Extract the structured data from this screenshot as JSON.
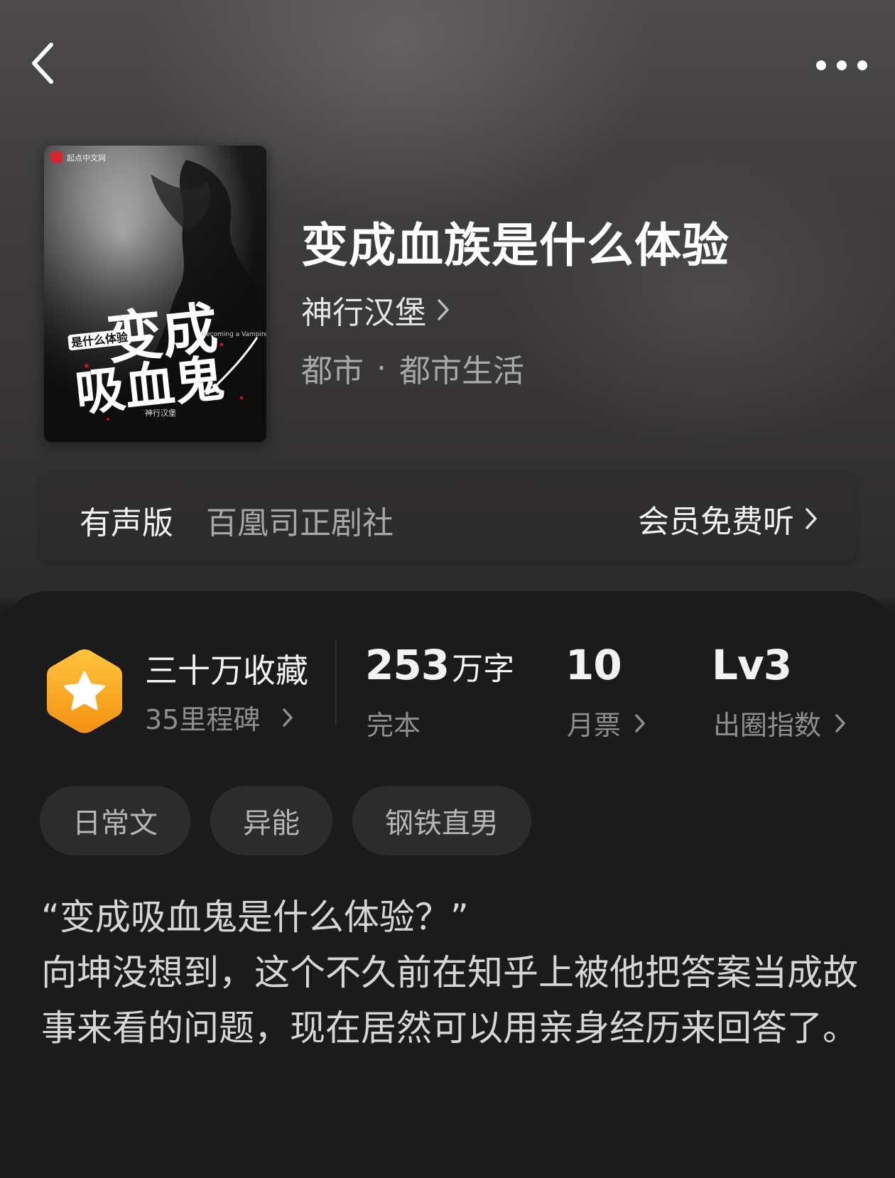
{
  "header": {
    "back_icon": "chevron-left-icon",
    "more_icon": "more-horizontal-icon"
  },
  "book": {
    "cover_alt": "book-cover",
    "title": "变成血族是什么体验",
    "author": "神行汉堡",
    "category": "都市",
    "category_separator": "·",
    "subcategory": "都市生活"
  },
  "audio": {
    "label": "有声版",
    "studio": "百凰司正剧社",
    "cta": "会员免费听"
  },
  "stats": {
    "collection_main": "三十万收藏",
    "collection_sub": "35里程碑",
    "words_value": "253",
    "words_unit": "万字",
    "words_sub": "完本",
    "tickets_value": "10",
    "tickets_sub": "月票",
    "level_value": "Lv3",
    "level_sub": "出圈指数",
    "badge_color": "#F7A21B"
  },
  "tags": [
    "日常文",
    "异能",
    "钢铁直男"
  ],
  "synopsis": {
    "line1": "“变成吸血鬼是什么体验？”",
    "line2": "向坤没想到，这个不久前在知乎上被他把答案当成故事来看的问题，现在居然可以用亲身经历来回答了。"
  },
  "cover_text": {
    "publisher": "起点中文网",
    "main_top": "变成",
    "main_bottom": "吸血鬼",
    "side": "是什么体验",
    "english": "Becoming a Vampire",
    "author_small": "神行汉堡"
  }
}
